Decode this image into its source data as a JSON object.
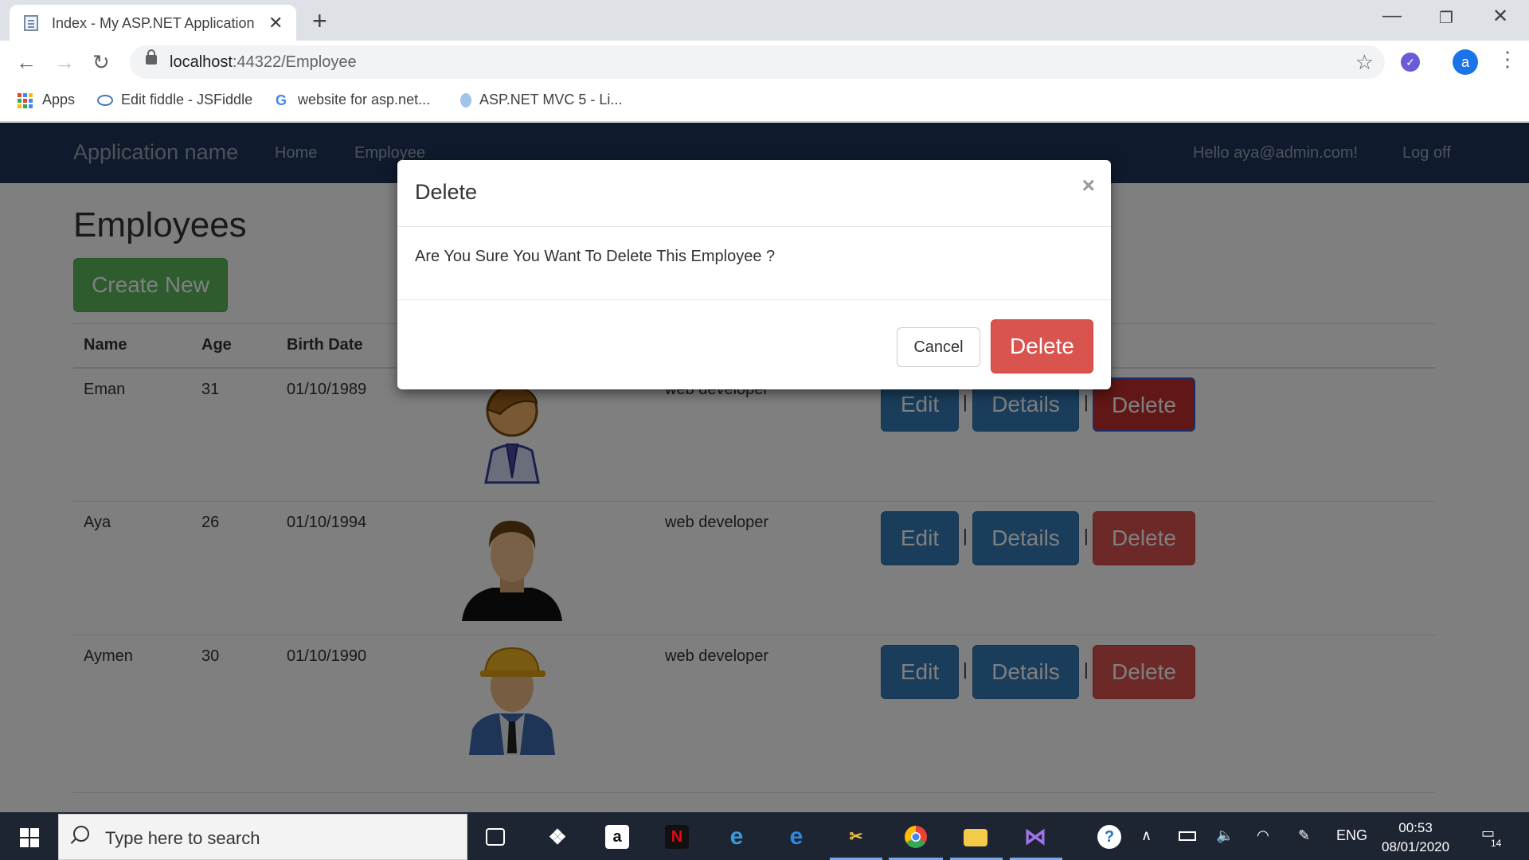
{
  "browser": {
    "tab_title": "Index - My ASP.NET Application",
    "url_host": "localhost",
    "url_rest": ":44322/Employee",
    "profile_initial": "a",
    "bookmarks": [
      {
        "label": "Apps",
        "icon": "apps-grid-icon"
      },
      {
        "label": "Edit fiddle - JSFiddle",
        "icon": "jsfiddle-icon"
      },
      {
        "label": "website for asp.net...",
        "icon": "google-icon"
      },
      {
        "label": "ASP.NET MVC 5 - Li...",
        "icon": "aspnet-icon"
      }
    ]
  },
  "navbar": {
    "brand": "Application name",
    "links": [
      "Home",
      "Employee"
    ],
    "greeting": "Hello aya@admin.com!",
    "logoff": "Log off",
    "color": "#1f3558"
  },
  "page": {
    "title": "Employees",
    "create_label": "Create New"
  },
  "table": {
    "headers": [
      "Name",
      "Age",
      "Birth Date"
    ],
    "rows": [
      {
        "name": "Eman",
        "age": "31",
        "birth_date": "01/10/1989",
        "job": "web developer",
        "avatar": "female-avatar-icon"
      },
      {
        "name": "Aya",
        "age": "26",
        "birth_date": "01/10/1994",
        "job": "web developer",
        "avatar": "male-avatar-icon"
      },
      {
        "name": "Aymen",
        "age": "30",
        "birth_date": "01/10/1990",
        "job": "web developer",
        "avatar": "worker-avatar-icon"
      }
    ],
    "actions": {
      "edit": "Edit",
      "details": "Details",
      "delete": "Delete",
      "separator": "|"
    }
  },
  "modal": {
    "title": "Delete",
    "close": "×",
    "body": "Are You Sure You Want To Delete This Employee ?",
    "cancel": "Cancel",
    "confirm": "Delete"
  },
  "taskbar": {
    "search_placeholder": "Type here to search",
    "language": "ENG",
    "time": "00:53",
    "date": "08/01/2020",
    "notifications": "14"
  },
  "colors": {
    "success": "#5cb85c",
    "primary": "#337ab7",
    "danger": "#d9534f"
  }
}
